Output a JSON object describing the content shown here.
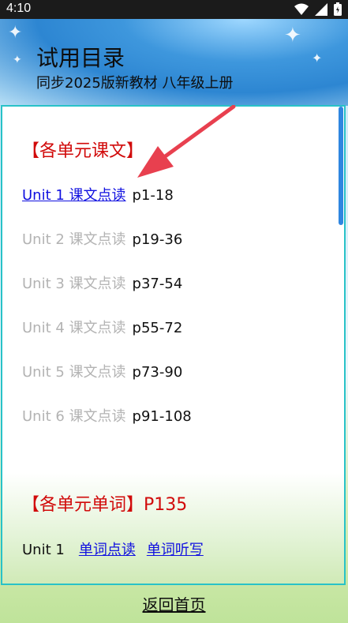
{
  "status_bar": {
    "time": "4:10",
    "icons": [
      "wifi-icon",
      "signal-icon",
      "battery-icon"
    ]
  },
  "header": {
    "title": "试用目录",
    "subtitle": "同步2025版新教材 八年级上册"
  },
  "sections": {
    "texts": {
      "heading": "【各单元课文】",
      "units": [
        {
          "label": "Unit 1 课文点读",
          "pages": "p1-18",
          "active": true
        },
        {
          "label": "Unit 2 课文点读",
          "pages": "p19-36",
          "active": false
        },
        {
          "label": "Unit 3 课文点读",
          "pages": "p37-54",
          "active": false
        },
        {
          "label": "Unit 4 课文点读",
          "pages": "p55-72",
          "active": false
        },
        {
          "label": "Unit 5 课文点读",
          "pages": "p73-90",
          "active": false
        },
        {
          "label": "Unit 6 课文点读",
          "pages": "p91-108",
          "active": false
        }
      ]
    },
    "vocab": {
      "heading": "【各单元单词】P135",
      "rows": [
        {
          "unit": "Unit 1",
          "links": [
            "单词点读",
            "单词听写"
          ]
        }
      ]
    }
  },
  "footer": {
    "back_home": "返回首页"
  },
  "colors": {
    "heading_red": "#d10a0a",
    "link_blue": "#1010e0",
    "disabled_gray": "#b3b3b3",
    "panel_border": "#28c2c8",
    "arrow_red": "#e8404f"
  }
}
